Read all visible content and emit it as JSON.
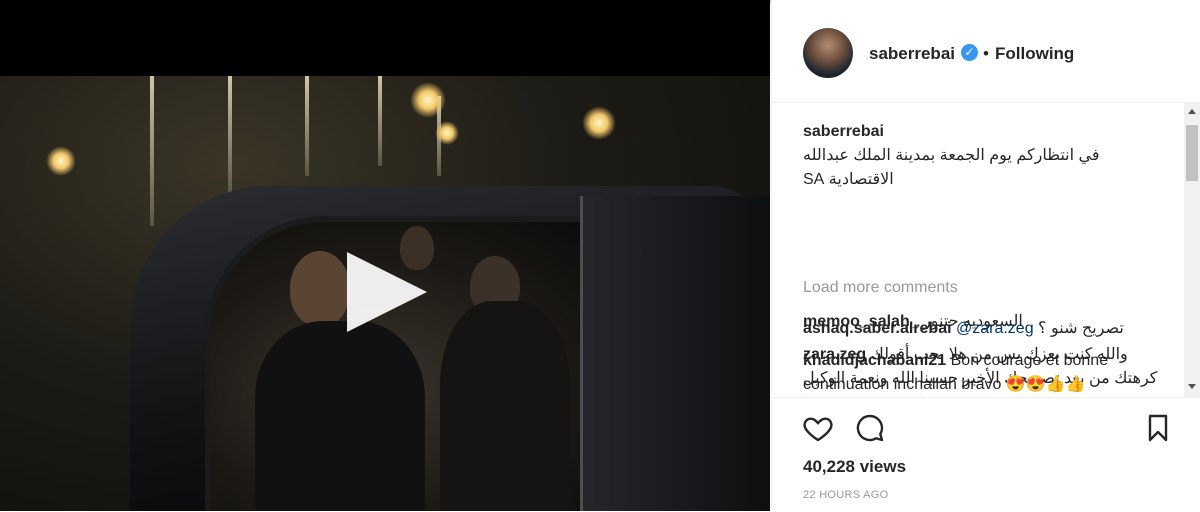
{
  "post": {
    "username": "saberrebai",
    "verified": true,
    "separator": "•",
    "follow_status": "Following"
  },
  "caption": {
    "username": "saberrebai",
    "text": "في انتظاركم يوم الجمعة بمدينة الملك عبدالله الاقتصادية SA"
  },
  "load_more_label": "Load more comments",
  "comments": [
    {
      "username": "memoo_salah_",
      "text": "السعوديه حتنور"
    },
    {
      "username": "zara.zeg",
      "text": "والله كنت بعزك بس من هلا بحب أقولك كرهتك من بعد تصريحك الأخير حسبنا الله ونعمة الوكيل فيكم طلعتو بتضحكو علينا"
    },
    {
      "username": "ashaq.saber.alrebai",
      "mention": "@zara.zeg",
      "text": "تصريح شنو ؟"
    },
    {
      "username": "khadidjachabani21",
      "text": "Bon courage et bonne continuation inchallah bravo 😍😍👍👍"
    }
  ],
  "stats": {
    "views": "40,228 views",
    "time": "22 HOURS AGO"
  },
  "icons": {
    "like": "heart-icon",
    "comment": "comment-icon",
    "save": "bookmark-icon",
    "play": "play-icon",
    "verified": "verified-badge-icon"
  },
  "colors": {
    "accent": "#3897f0",
    "muted": "#999999",
    "text": "#262626",
    "mention": "#003569"
  }
}
